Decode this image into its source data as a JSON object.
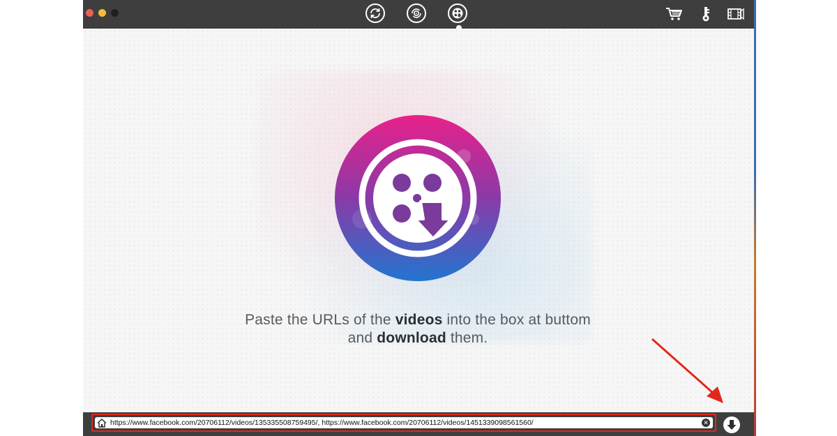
{
  "titlebar": {
    "mode_buttons": [
      {
        "icon": "convert-icon",
        "active": false
      },
      {
        "icon": "burn-disc-icon",
        "active": false
      },
      {
        "icon": "video-download-icon",
        "active": true
      }
    ],
    "tools": [
      {
        "icon": "cart-icon"
      },
      {
        "icon": "key-icon"
      },
      {
        "icon": "media-tools-icon"
      }
    ]
  },
  "main": {
    "logo_icon": "video-download-logo-icon",
    "message": {
      "part1": "Paste the URLs of the ",
      "bold1": "videos",
      "part2": " into the box at buttom",
      "part3": "and ",
      "bold2": "download",
      "part4": " them."
    }
  },
  "bottombar": {
    "url_value": "https://www.facebook.com/20706112/videos/135335508759495/, https://www.facebook.com/20706112/videos/1451339098561560/",
    "clear_glyph": "✕"
  },
  "colors": {
    "titlebar": "#3e3e3e",
    "highlight": "#e3271a",
    "logo_gradient_top": "#e02a8e",
    "logo_gradient_bottom": "#2a6fc7"
  }
}
